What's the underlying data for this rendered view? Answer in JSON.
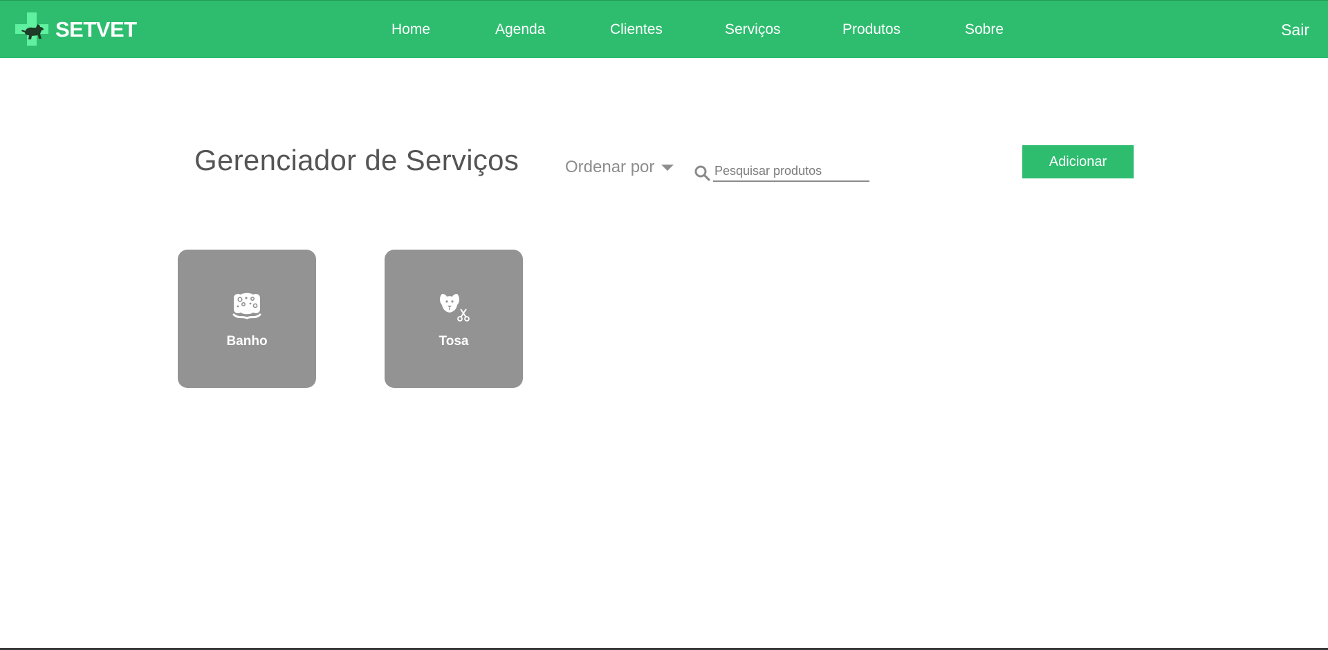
{
  "brand": {
    "name": "SETVET",
    "logo_icon": "vet-cross-dog-icon",
    "logo_color": "#5ff0a0"
  },
  "nav": {
    "links": [
      {
        "label": "Home"
      },
      {
        "label": "Agenda"
      },
      {
        "label": "Clientes"
      },
      {
        "label": "Serviços"
      },
      {
        "label": "Produtos"
      },
      {
        "label": "Sobre"
      }
    ],
    "exit_label": "Sair"
  },
  "main": {
    "title": "Gerenciador de Serviços",
    "sort_label": "Ordenar por",
    "search_placeholder": "Pesquisar produtos",
    "search_value": "",
    "add_label": "Adicionar"
  },
  "services": [
    {
      "label": "Banho",
      "icon": "sponge-icon"
    },
    {
      "label": "Tosa",
      "icon": "dog-scissors-icon"
    }
  ],
  "colors": {
    "primary": "#2ebd6f",
    "card": "#939393",
    "title": "#555555"
  }
}
